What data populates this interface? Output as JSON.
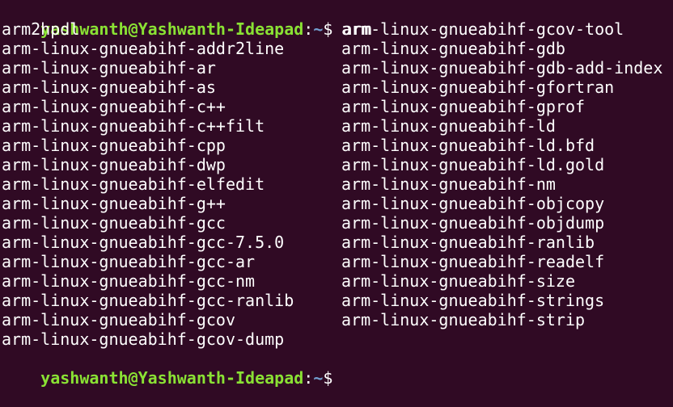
{
  "terminal": {
    "background": "#300a24",
    "foreground": "#ffffff",
    "user_color": "#8ae234",
    "path_color": "#729fcf",
    "prompt": {
      "user_host": "yashwanth@Yashwanth-Ideapad",
      "colon": ":",
      "path": "~",
      "symbol": "$ ",
      "command": "arm"
    },
    "completions_left": [
      "arm2hpdl",
      "arm-linux-gnueabihf-addr2line",
      "arm-linux-gnueabihf-ar",
      "arm-linux-gnueabihf-as",
      "arm-linux-gnueabihf-c++",
      "arm-linux-gnueabihf-c++filt",
      "arm-linux-gnueabihf-cpp",
      "arm-linux-gnueabihf-dwp",
      "arm-linux-gnueabihf-elfedit",
      "arm-linux-gnueabihf-g++",
      "arm-linux-gnueabihf-gcc",
      "arm-linux-gnueabihf-gcc-7.5.0",
      "arm-linux-gnueabihf-gcc-ar",
      "arm-linux-gnueabihf-gcc-nm",
      "arm-linux-gnueabihf-gcc-ranlib",
      "arm-linux-gnueabihf-gcov",
      "arm-linux-gnueabihf-gcov-dump"
    ],
    "completions_right": [
      "arm-linux-gnueabihf-gcov-tool",
      "arm-linux-gnueabihf-gdb",
      "arm-linux-gnueabihf-gdb-add-index",
      "arm-linux-gnueabihf-gfortran",
      "arm-linux-gnueabihf-gprof",
      "arm-linux-gnueabihf-ld",
      "arm-linux-gnueabihf-ld.bfd",
      "arm-linux-gnueabihf-ld.gold",
      "arm-linux-gnueabihf-nm",
      "arm-linux-gnueabihf-objcopy",
      "arm-linux-gnueabihf-objdump",
      "arm-linux-gnueabihf-ranlib",
      "arm-linux-gnueabihf-readelf",
      "arm-linux-gnueabihf-size",
      "arm-linux-gnueabihf-strings",
      "arm-linux-gnueabihf-strip"
    ],
    "next_prompt": {
      "user_host": "yashwanth@Yashwanth-Ideapad",
      "colon": ":",
      "path": "~",
      "symbol": "$ "
    }
  }
}
